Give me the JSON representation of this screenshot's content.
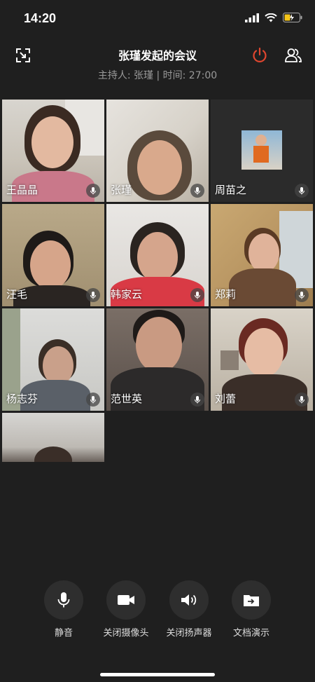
{
  "status_bar": {
    "time": "14:20"
  },
  "header": {
    "title": "张瑾发起的会议",
    "subtitle": "主持人: 张瑾 | 时间: 27:00",
    "end_color": "#e0462f"
  },
  "participants": [
    {
      "name": "王晶晶"
    },
    {
      "name": "张瑾"
    },
    {
      "name": "周苗之"
    },
    {
      "name": "汪毛"
    },
    {
      "name": "韩家云"
    },
    {
      "name": "郑莉"
    },
    {
      "name": "杨志芬"
    },
    {
      "name": "范世英"
    },
    {
      "name": "刘蕾"
    }
  ],
  "controls": {
    "mute": "静音",
    "camera": "关闭摄像头",
    "speaker": "关闭扬声器",
    "share": "文档演示"
  }
}
